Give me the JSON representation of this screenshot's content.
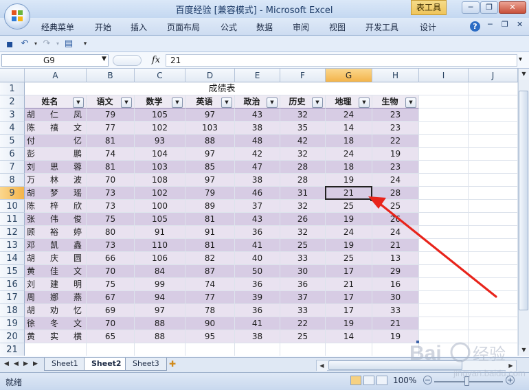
{
  "window": {
    "title": "百度经验  [兼容模式] - Microsoft Excel",
    "context_tab": "表工具",
    "buttons": {
      "minimize": "─",
      "restore": "❐",
      "close": "✕"
    }
  },
  "ribbon": {
    "tabs": [
      "经典菜单",
      "开始",
      "插入",
      "页面布局",
      "公式",
      "数据",
      "审阅",
      "视图",
      "开发工具",
      "设计"
    ],
    "help_icon": "?"
  },
  "quick_access": {
    "icons": [
      "save-icon",
      "undo-icon",
      "redo-icon",
      "print-preview-icon",
      "customize-icon"
    ],
    "glyphs": {
      "save": "▪",
      "undo": "↶",
      "redo": "↷",
      "preview": "▤",
      "customize": "▾"
    }
  },
  "formula_bar": {
    "name_box": "G9",
    "fx": "fx",
    "value": "21"
  },
  "grid": {
    "columns": [
      "A",
      "B",
      "C",
      "D",
      "E",
      "F",
      "G",
      "H",
      "I",
      "J"
    ],
    "selected_column": "G",
    "selected_row": 9,
    "rows": [
      1,
      2,
      3,
      4,
      5,
      6,
      7,
      8,
      9,
      10,
      11,
      12,
      13,
      14,
      15,
      16,
      17,
      18,
      19,
      20,
      21
    ],
    "table_title": "成绩表",
    "headers": [
      "姓名",
      "语文",
      "数学",
      "英语",
      "政治",
      "历史",
      "地理",
      "生物"
    ],
    "filter_glyph": "▼",
    "students": [
      {
        "name": "胡仁凤",
        "scores": [
          79,
          105,
          97,
          43,
          32,
          24,
          23
        ]
      },
      {
        "name": "陈禧文",
        "scores": [
          77,
          102,
          103,
          38,
          35,
          14,
          23
        ]
      },
      {
        "name": "付 亿",
        "scores": [
          81,
          93,
          88,
          48,
          42,
          18,
          22
        ]
      },
      {
        "name": "彭 鹏",
        "scores": [
          74,
          104,
          97,
          42,
          32,
          24,
          19
        ]
      },
      {
        "name": "刘思蓉",
        "scores": [
          81,
          103,
          85,
          47,
          28,
          18,
          23
        ]
      },
      {
        "name": "万林波",
        "scores": [
          70,
          108,
          97,
          38,
          28,
          19,
          24
        ]
      },
      {
        "name": "胡梦瑶",
        "scores": [
          73,
          102,
          79,
          46,
          31,
          21,
          28
        ]
      },
      {
        "name": "陈梓欣",
        "scores": [
          73,
          100,
          89,
          37,
          32,
          25,
          25
        ]
      },
      {
        "name": "张伟俊",
        "scores": [
          75,
          105,
          81,
          43,
          26,
          19,
          26
        ]
      },
      {
        "name": "顾裕婷",
        "scores": [
          80,
          91,
          91,
          36,
          32,
          24,
          24
        ]
      },
      {
        "name": "邓凯鑫",
        "scores": [
          73,
          110,
          81,
          41,
          25,
          19,
          21
        ]
      },
      {
        "name": "胡庆圆",
        "scores": [
          66,
          106,
          82,
          40,
          33,
          25,
          13
        ]
      },
      {
        "name": "黄佳文",
        "scores": [
          70,
          84,
          87,
          50,
          30,
          17,
          29
        ]
      },
      {
        "name": "刘建明",
        "scores": [
          75,
          99,
          74,
          36,
          36,
          21,
          16
        ]
      },
      {
        "name": "周娜燕",
        "scores": [
          67,
          94,
          77,
          39,
          37,
          17,
          30
        ]
      },
      {
        "name": "胡劝忆",
        "scores": [
          69,
          97,
          78,
          36,
          33,
          17,
          33
        ]
      },
      {
        "name": "徐冬文",
        "scores": [
          70,
          88,
          90,
          41,
          22,
          19,
          21
        ]
      },
      {
        "name": "黄实横",
        "scores": [
          65,
          88,
          95,
          38,
          25,
          14,
          19
        ]
      }
    ]
  },
  "sheet_tabs": [
    "Sheet1",
    "Sheet2",
    "Sheet3"
  ],
  "active_sheet": "Sheet2",
  "nav_glyphs": {
    "first": "◀",
    "prev": "◀",
    "next": "▶",
    "last": "▶",
    "new_sheet": "✚"
  },
  "statusbar": {
    "text": "就绪",
    "zoom": "100%",
    "zoom_minus": "−",
    "zoom_plus": "+"
  },
  "colors": {
    "row_odd": "#d7cce4",
    "row_even": "#e9e2f0",
    "header_row": "#eeeaf3",
    "accent": "#f3b44a",
    "arrow": "#e8241b"
  },
  "watermark": {
    "brand": "Bai",
    "cn": "经验",
    "url": "jingyan.baidu.com"
  }
}
